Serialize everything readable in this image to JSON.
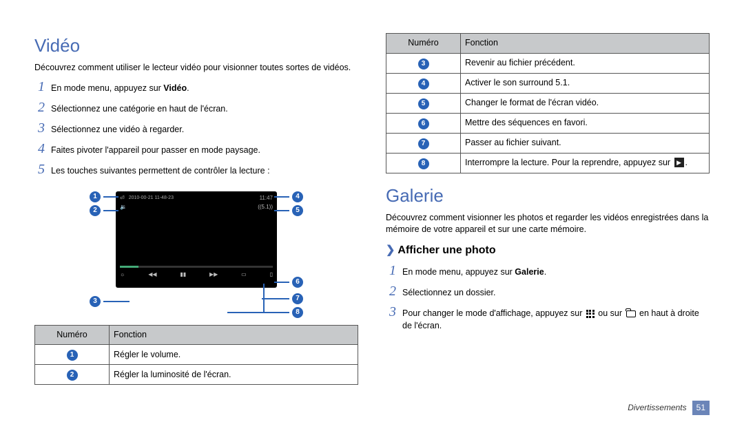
{
  "left": {
    "heading": "Vidéo",
    "intro": "Découvrez comment utiliser le lecteur vidéo pour visionner toutes sortes de vidéos.",
    "steps": [
      {
        "n": "1",
        "prefix": "En mode menu, appuyez sur ",
        "bold": "Vidéo",
        "suffix": "."
      },
      {
        "n": "2",
        "text": "Sélectionnez une catégorie en haut de l'écran."
      },
      {
        "n": "3",
        "text": "Sélectionnez une vidéo à regarder."
      },
      {
        "n": "4",
        "text": "Faites pivoter l'appareil pour passer en mode paysage."
      },
      {
        "n": "5",
        "text": "Les touches suivantes permettent de contrôler la lecture :"
      }
    ],
    "callouts": {
      "c1": "1",
      "c2": "2",
      "c3": "3",
      "c4": "4",
      "c5": "5",
      "c6": "6",
      "c7": "7",
      "c8": "8"
    },
    "video_overlay": {
      "title": "2010-00-21 11-48-23",
      "time": "11:47"
    },
    "table": {
      "h1": "Numéro",
      "h2": "Fonction",
      "rows": [
        {
          "n": "1",
          "fn": "Régler le volume."
        },
        {
          "n": "2",
          "fn": "Régler la luminosité de l'écran."
        }
      ]
    }
  },
  "right": {
    "table": {
      "h1": "Numéro",
      "h2": "Fonction",
      "rows": [
        {
          "n": "3",
          "fn": "Revenir au fichier précédent."
        },
        {
          "n": "4",
          "fn": "Activer le son surround 5.1."
        },
        {
          "n": "5",
          "fn": "Changer le format de l'écran vidéo."
        },
        {
          "n": "6",
          "fn": "Mettre des séquences en favori."
        },
        {
          "n": "7",
          "fn": "Passer au fichier suivant."
        },
        {
          "n": "8",
          "fn_before": "Interrompre la lecture. Pour la reprendre, appuyez sur ",
          "fn_after": "."
        }
      ]
    },
    "heading": "Galerie",
    "intro": "Découvrez comment visionner les photos et regarder les vidéos enregistrées dans la mémoire de votre appareil et sur une carte mémoire.",
    "sub_title": "Afficher une photo",
    "steps": [
      {
        "n": "1",
        "prefix": "En mode menu, appuyez sur ",
        "bold": "Galerie",
        "suffix": "."
      },
      {
        "n": "2",
        "text": "Sélectionnez un dossier."
      },
      {
        "n": "3",
        "before": "Pour changer le mode d'affichage, appuyez sur ",
        "mid": " ou sur ",
        "after": " en haut à droite de l'écran."
      }
    ]
  },
  "footer": {
    "section": "Divertissements",
    "page": "51"
  }
}
